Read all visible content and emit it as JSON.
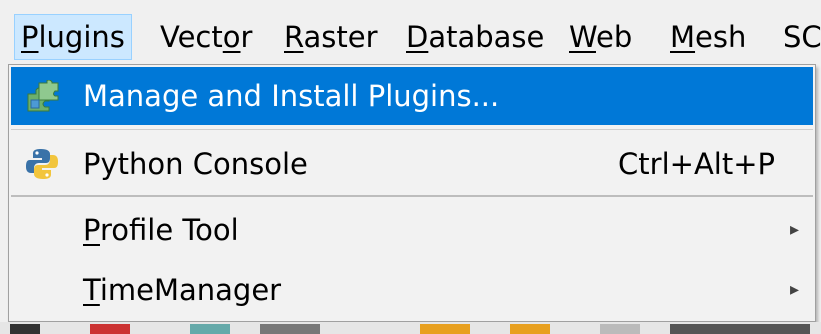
{
  "menubar": {
    "items": [
      {
        "label": "Plugins",
        "open": true
      },
      {
        "label": "Vector"
      },
      {
        "label": "Raster"
      },
      {
        "label": "Database"
      },
      {
        "label": "Web"
      },
      {
        "label": "Mesh"
      },
      {
        "label": "SC"
      }
    ]
  },
  "plugins_menu": {
    "items": [
      {
        "label": "Manage and Install Plugins...",
        "highlighted": true,
        "icon": "puzzle-plugins-icon"
      },
      {
        "label": "Python Console",
        "shortcut": "Ctrl+Alt+P",
        "icon": "python-icon"
      },
      {
        "label": "Profile Tool",
        "submenu": true
      },
      {
        "label": "TimeManager",
        "submenu": true
      }
    ],
    "submenu_arrow": "▸"
  },
  "colors": {
    "highlight": "#0078d7",
    "menubar_open": "#cce8ff"
  }
}
